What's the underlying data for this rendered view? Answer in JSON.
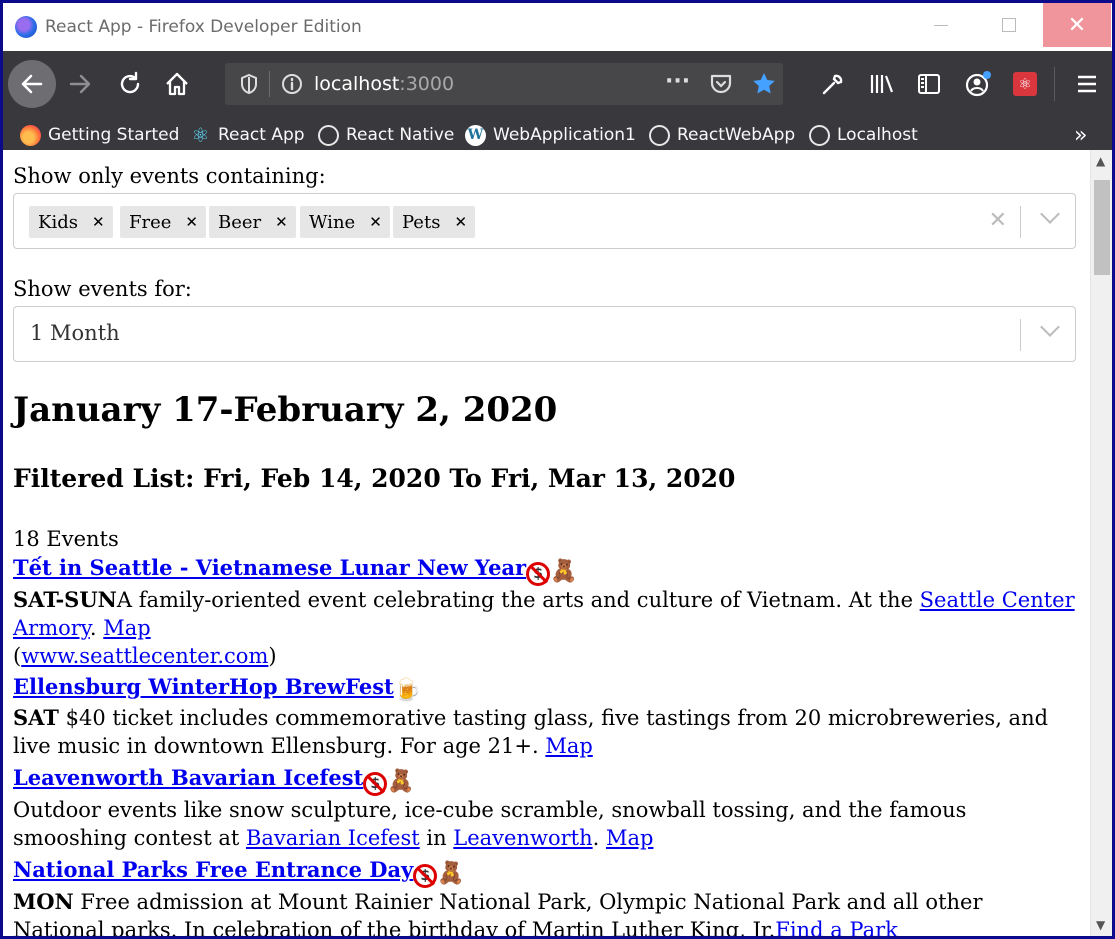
{
  "window": {
    "title": "React App - Firefox Developer Edition"
  },
  "navbar": {
    "url_host": "localhost",
    "url_port": ":3000"
  },
  "bookmarks": [
    {
      "label": "Getting Started",
      "icon": "firefox-icon"
    },
    {
      "label": "React App",
      "icon": "react-icon"
    },
    {
      "label": "React Native",
      "icon": "globe-icon"
    },
    {
      "label": "WebApplication1",
      "icon": "wordpress-icon"
    },
    {
      "label": "ReactWebApp",
      "icon": "globe-icon"
    },
    {
      "label": "Localhost",
      "icon": "globe-icon"
    }
  ],
  "filters": {
    "contains_label": "Show only events containing:",
    "tags": [
      "Kids",
      "Free",
      "Beer",
      "Wine",
      "Pets"
    ],
    "period_label": "Show events for:",
    "period_value": "1 Month"
  },
  "range_heading": "January 17-February 2, 2020",
  "filtered_heading": "Filtered List: Fri, Feb 14, 2020 To Fri, Mar 13, 2020",
  "events_count": "18 Events",
  "events": [
    {
      "title": "Tết in Seattle - Vietnamese Lunar New Year",
      "day": "SAT-SUN",
      "text": "A family-oriented event celebrating the arts and culture of Vietnam. At the ",
      "venue": "Seattle Center Armory",
      "map": "Map",
      "site_open": "(",
      "site": "www.seattlecenter.com",
      "site_close": ")"
    },
    {
      "title": "Ellensburg WinterHop BrewFest",
      "day": "SAT",
      "text": " $40 ticket includes commemorative tasting glass, five tastings from 20 microbreweries, and live music in downtown Ellensburg. For age 21+. ",
      "map": "Map"
    },
    {
      "title": "Leavenworth Bavarian Icefest",
      "text": "Outdoor events like snow sculpture, ice-cube scramble, snowball tossing, and the famous smooshing contest at ",
      "link1": "Bavarian Icefest",
      "mid": " in ",
      "link2": "Leavenworth",
      "sep": ". ",
      "map": "Map"
    },
    {
      "title": "National Parks Free Entrance Day",
      "day": "MON",
      "text": " Free admission at Mount Rainier National Park, Olympic National Park and all other National parks. In celebration of the birthday of Martin Luther King, Jr.",
      "link": "Find a Park"
    }
  ]
}
